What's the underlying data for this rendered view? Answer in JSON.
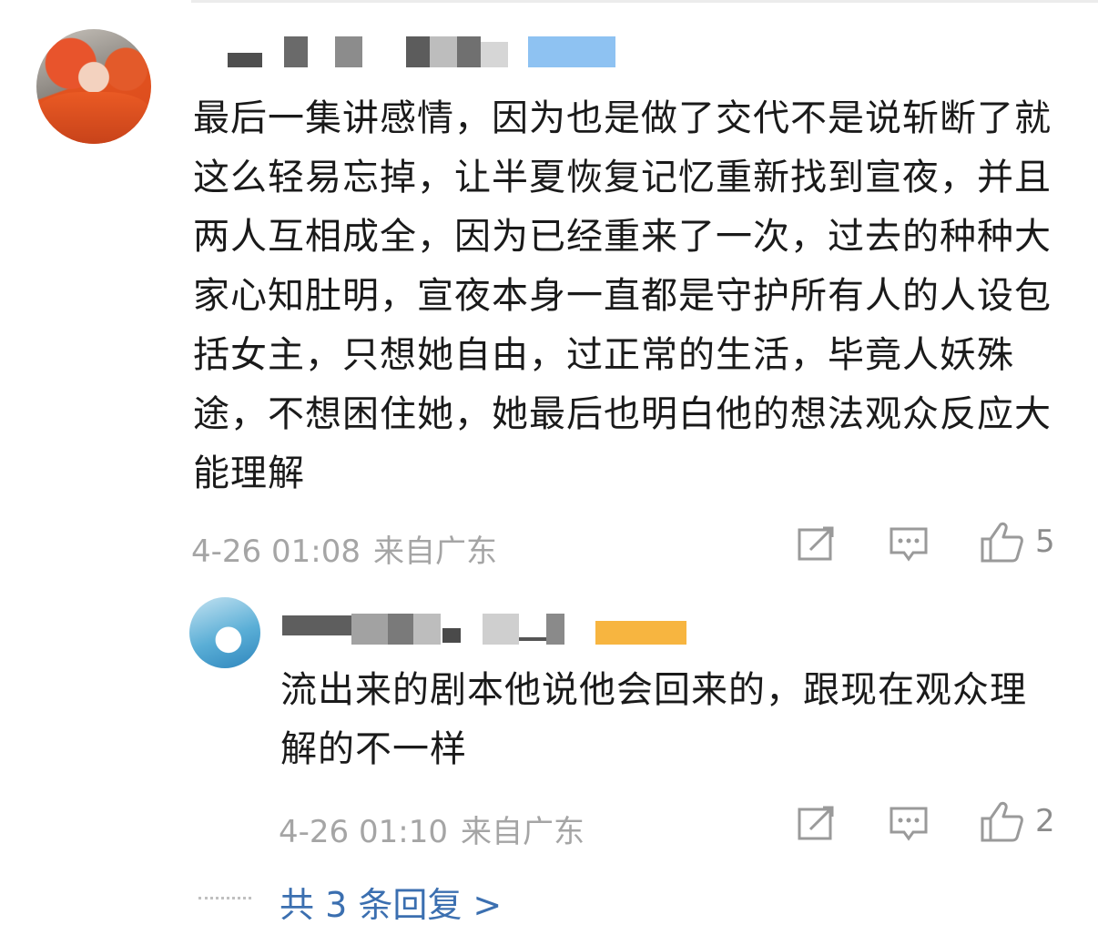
{
  "main_comment": {
    "text": "最后一集讲感情，因为也是做了交代不是说斩断了就这么轻易忘掉，让半夏恢复记忆重新找到宣夜，并且两人互相成全，因为已经重来了一次，过去的种种大家心知肚明，宣夜本身一直都是守护所有人的人设包括女主，只想她自由，过正常的生活，毕竟人妖殊途，不想困住她，她最后也明白他的想法观众反应大能理解",
    "time": "4-26 01:08",
    "location": "来自广东",
    "likes": "5"
  },
  "reply": {
    "text": "流出来的剧本他说他会回来的，跟现在观众理解的不一样",
    "time": "4-26 01:10",
    "location": "来自广东",
    "likes": "2"
  },
  "more_replies": "共 3 条回复 >",
  "icons": [
    "share-icon",
    "comment-icon",
    "like-icon"
  ],
  "colors": {
    "link": "#3b6fb0",
    "meta": "#a5a5a5"
  }
}
